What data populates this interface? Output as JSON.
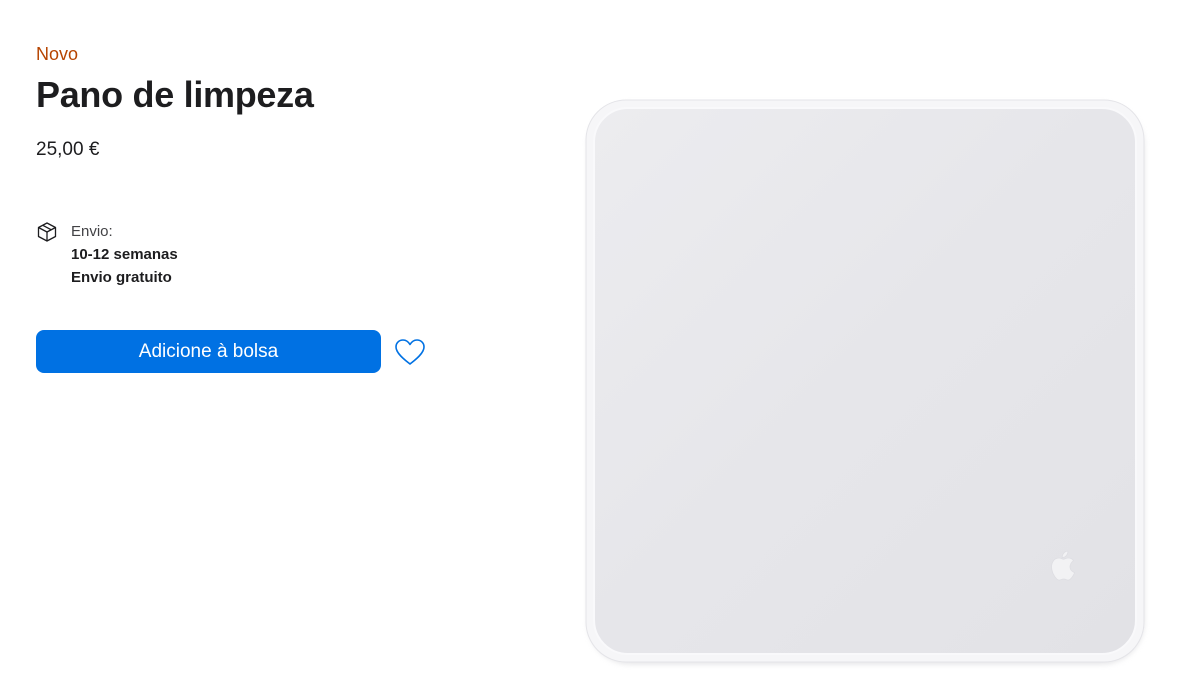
{
  "product": {
    "badge": "Novo",
    "title": "Pano de limpeza",
    "price": "25,00 €"
  },
  "shipping": {
    "icon": "box-icon",
    "label": "Envio:",
    "time": "10-12 semanas",
    "cost": "Envio gratuito"
  },
  "actions": {
    "add_to_bag_label": "Adicione à bolsa",
    "favorite_icon": "heart-icon"
  },
  "colors": {
    "badge": "#b64400",
    "primary_button": "#0071e3",
    "text": "#1d1d1f"
  },
  "image": {
    "logo_icon": "apple-logo-icon"
  }
}
